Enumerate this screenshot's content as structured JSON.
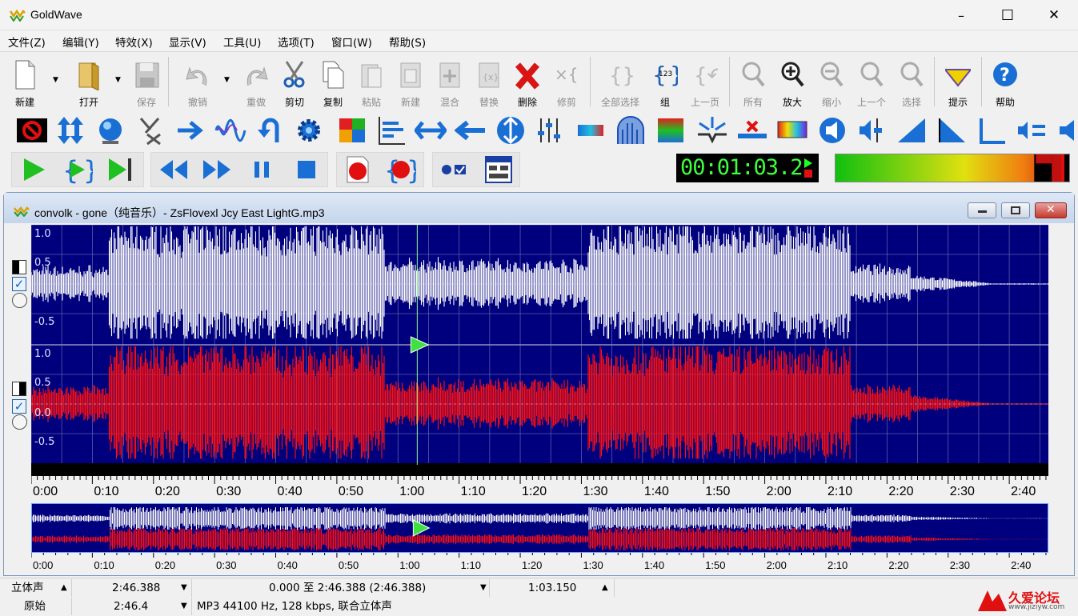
{
  "window": {
    "title": "GoldWave",
    "minimize": "–",
    "maximize": "☐",
    "close": "✕"
  },
  "menu": [
    "文件(Z)",
    "编辑(Y)",
    "特效(X)",
    "显示(V)",
    "工具(U)",
    "选项(T)",
    "窗口(W)",
    "帮助(S)"
  ],
  "toolbar": [
    {
      "label": "新建",
      "icon": "new-file-icon",
      "enabled": true
    },
    {
      "label": "打开",
      "icon": "open-folder-icon",
      "enabled": true
    },
    {
      "label": "保存",
      "icon": "save-disk-icon",
      "enabled": false
    },
    {
      "label": "撤销",
      "icon": "undo-icon",
      "enabled": false
    },
    {
      "label": "重做",
      "icon": "redo-icon",
      "enabled": false
    },
    {
      "label": "剪切",
      "icon": "scissors-icon",
      "enabled": true
    },
    {
      "label": "复制",
      "icon": "copy-icon",
      "enabled": true
    },
    {
      "label": "粘贴",
      "icon": "paste-icon",
      "enabled": false
    },
    {
      "label": "新建",
      "icon": "paste-new-icon",
      "enabled": false
    },
    {
      "label": "混合",
      "icon": "mix-icon",
      "enabled": false
    },
    {
      "label": "替换",
      "icon": "replace-icon",
      "enabled": false
    },
    {
      "label": "删除",
      "icon": "delete-x-icon",
      "enabled": true
    },
    {
      "label": "修剪",
      "icon": "trim-icon",
      "enabled": false
    },
    {
      "label": "全部选择",
      "icon": "select-all-icon",
      "enabled": false
    },
    {
      "label": "组",
      "icon": "set-icon",
      "enabled": true
    },
    {
      "label": "上一页",
      "icon": "previous-icon",
      "enabled": false
    },
    {
      "label": "所有",
      "icon": "zoom-all-icon",
      "enabled": false
    },
    {
      "label": "放大",
      "icon": "zoom-in-icon",
      "enabled": true
    },
    {
      "label": "缩小",
      "icon": "zoom-out-icon",
      "enabled": false
    },
    {
      "label": "上一个",
      "icon": "zoom-previous-icon",
      "enabled": false
    },
    {
      "label": "选择",
      "icon": "zoom-select-icon",
      "enabled": false
    },
    {
      "label": "提示",
      "icon": "cue-icon",
      "enabled": true
    },
    {
      "label": "帮助",
      "icon": "help-icon",
      "enabled": true
    }
  ],
  "effects_toolbar": [
    "stop-sign-icon",
    "resize-arrows-icon",
    "globe-icon",
    "swap-channels-icon",
    "merge-arrow-icon",
    "waveform-icon",
    "loop-back-icon",
    "gear-icon",
    "color-puzzle-icon",
    "levels-chart-icon",
    "expand-arrows-icon",
    "left-arrow-icon",
    "vertical-expand-icon",
    "equalizer-sliders-icon",
    "color-bar-icon",
    "arch-filter-icon",
    "spectrum-icon",
    "noise-reduce-icon",
    "clip-icon",
    "rainbow-icon",
    "speaker-icon",
    "volume-slider-icon",
    "fade-in-icon",
    "fade-out-icon",
    "marker-icon",
    "volume-equal-icon",
    "speaker-right-icon"
  ],
  "playback": {
    "time": "00:01:03.2"
  },
  "document": {
    "title": "convolk - gone（纯音乐）- ZsFlovexl Jcy East LightG.mp3"
  },
  "axis": {
    "upper": [
      "1.0",
      "0.5",
      "",
      "-0.5"
    ],
    "lower": [
      "1.0",
      "0.5",
      "0.0",
      "-0.5"
    ]
  },
  "timeline": [
    "0:00",
    "0:10",
    "0:20",
    "0:30",
    "0:40",
    "0:50",
    "1:00",
    "1:10",
    "1:20",
    "1:30",
    "1:40",
    "1:50",
    "2:00",
    "2:10",
    "2:20",
    "2:30",
    "2:40"
  ],
  "overview_timeline": [
    "0:00",
    "0:10",
    "0:20",
    "0:30",
    "0:40",
    "0:50",
    "1:00",
    "1:10",
    "1:20",
    "1:30",
    "1:40",
    "1:50",
    "2:00",
    "2:10",
    "2:20",
    "2:30",
    "2:40"
  ],
  "status": {
    "channels": "立体声",
    "duration": "2:46.388",
    "selection": "0.000 至 2:46.388 (2:46.388)",
    "position": "1:03.150",
    "mode": "原始",
    "length2": "2:46.4",
    "format": "MP3 44100 Hz, 128 kbps, 联合立体声"
  },
  "watermark": {
    "text": "久爱论坛",
    "url": "www.jiziyw.com"
  },
  "colors": {
    "wave_bg": "#00007e",
    "left_channel": "#ffffff",
    "right_channel": "#ff1010",
    "time_digits": "#3cff3c"
  }
}
